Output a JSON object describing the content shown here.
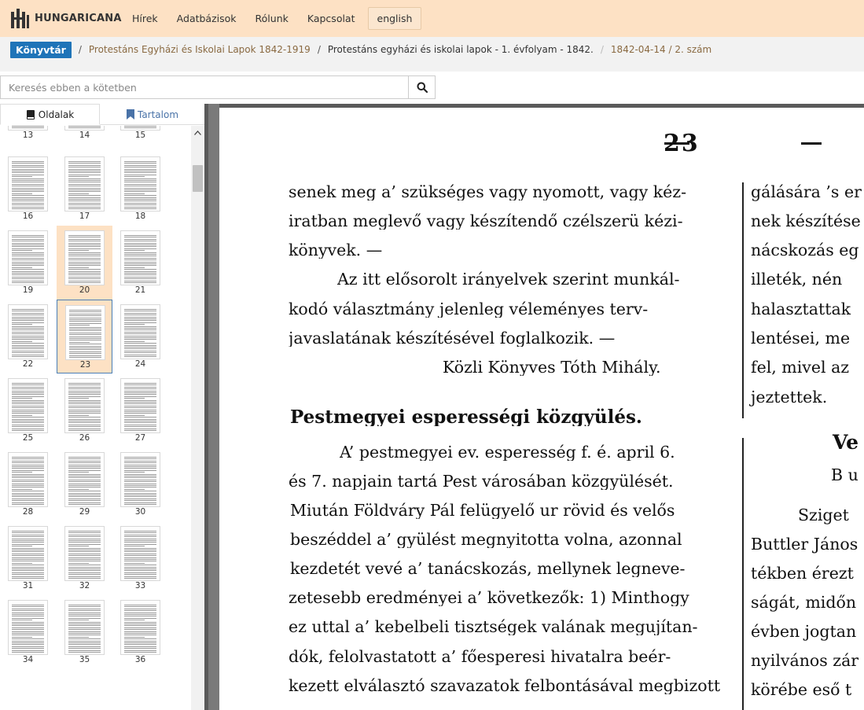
{
  "header": {
    "logo_text": "HUNGARICANA",
    "nav": [
      "Hírek",
      "Adatbázisok",
      "Rólunk",
      "Kapcsolat"
    ],
    "lang": "english"
  },
  "breadcrumb": {
    "home": "Könyvtár",
    "items": [
      "Protestáns Egyházi és Iskolai Lapok 1842-1919",
      "Protestáns egyházi és iskolai lapok - 1. évfolyam - 1842.",
      "1842-04-14 / 2. szám"
    ]
  },
  "search": {
    "placeholder": "Keresés ebben a kötetben"
  },
  "tabs": {
    "pages": "Oldalak",
    "contents": "Tartalom"
  },
  "thumbnails": {
    "row_partial": [
      "13",
      "14",
      "15"
    ],
    "rows": [
      [
        "16",
        "17",
        "18"
      ],
      [
        "19",
        "20",
        "21"
      ],
      [
        "22",
        "23",
        "24"
      ],
      [
        "25",
        "26",
        "27"
      ],
      [
        "28",
        "29",
        "30"
      ],
      [
        "31",
        "32",
        "33"
      ],
      [
        "34",
        "35",
        "36"
      ]
    ],
    "selected": "23",
    "highlighted": "20"
  },
  "page": {
    "number": "23",
    "left_column": [
      "senek meg a’ szükséges vagy nyomott, vagy kéz-",
      "iratban meglevő vagy készítendő czélszerü kézi-",
      "könyvek. —",
      "Az itt elősorolt irányelvek szerint munkál-",
      "kodó választmány jelenleg véleményes terv-",
      "javaslatának készítésével foglalkozik. —",
      "Közli Könyves Tóth Mihály.",
      "Pestmegyei esperességi közgyülés.",
      "A’ pestmegyei ev. esperesség f. é. april 6.",
      "és 7. napjain tartá Pest városában közgyülését.",
      "Miután Földváry Pál felügyelő ur rövid és velős",
      "beszéddel a’ gyülést megnyitotta volna, azonnal",
      "kezdetét vevé a’ tanácskozás, mellynek legneve-",
      "zetesebb eredményei a’ következők: 1) Minthogy",
      "ez uttal a’ kebelbeli tisztségek valának megujítan-",
      "dók, felolvastatott a’ főesperesi hivatalra beér-",
      "kezett elválasztó szavazatok felbontásával megbizott"
    ],
    "right_column": [
      "gálására ’s er",
      "nek készítése",
      "nácskozás eg",
      "illeték, nén",
      "halasztattak",
      "lentései, me",
      "fel, mivel az",
      "jeztettek.",
      "Ve",
      "B u",
      "Sziget",
      "Buttler János",
      "tékben érezt",
      "ságát, midőn",
      "évben jogtan",
      "nyilvános zár",
      "körébe eső t"
    ]
  }
}
